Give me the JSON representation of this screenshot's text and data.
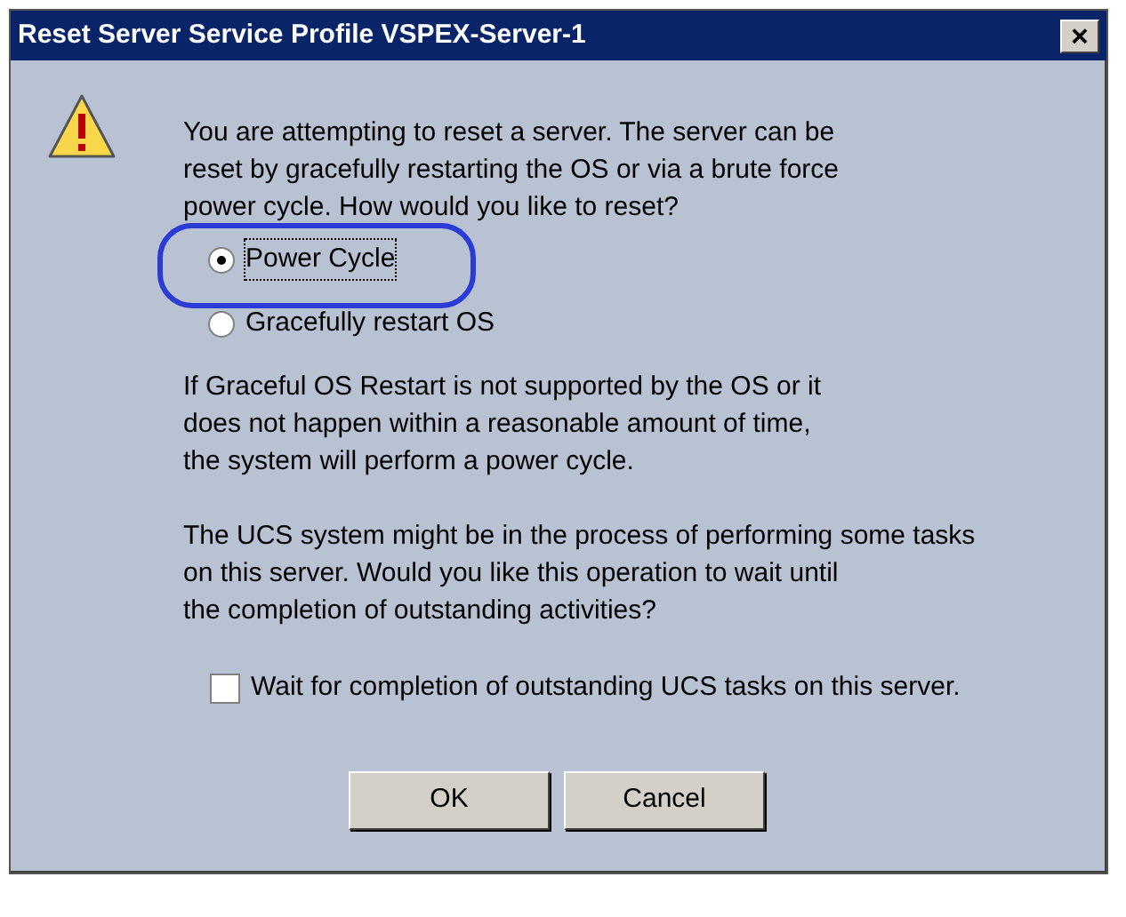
{
  "window": {
    "title": "Reset Server Service Profile VSPEX-Server-1",
    "close": "×"
  },
  "message": "You are attempting to reset a server. The server can be\nreset by gracefully restarting the OS or via a brute force\npower cycle. How would you like to reset?",
  "options": [
    {
      "label": "Power Cycle",
      "selected": true,
      "highlighted": true
    },
    {
      "label": "Gracefully restart OS",
      "selected": false,
      "highlighted": false
    }
  ],
  "note": "If Graceful OS Restart is not supported by the OS or it\ndoes not happen within a reasonable amount of time,\nthe system will perform a power cycle.",
  "question": "The UCS system might be in the process of performing some tasks\non this server. Would you like this operation to wait until\nthe completion of outstanding activities?",
  "wait_checkbox": {
    "label": "Wait for completion of outstanding UCS tasks on this server.",
    "checked": false
  },
  "buttons": [
    "OK",
    "Cancel"
  ]
}
